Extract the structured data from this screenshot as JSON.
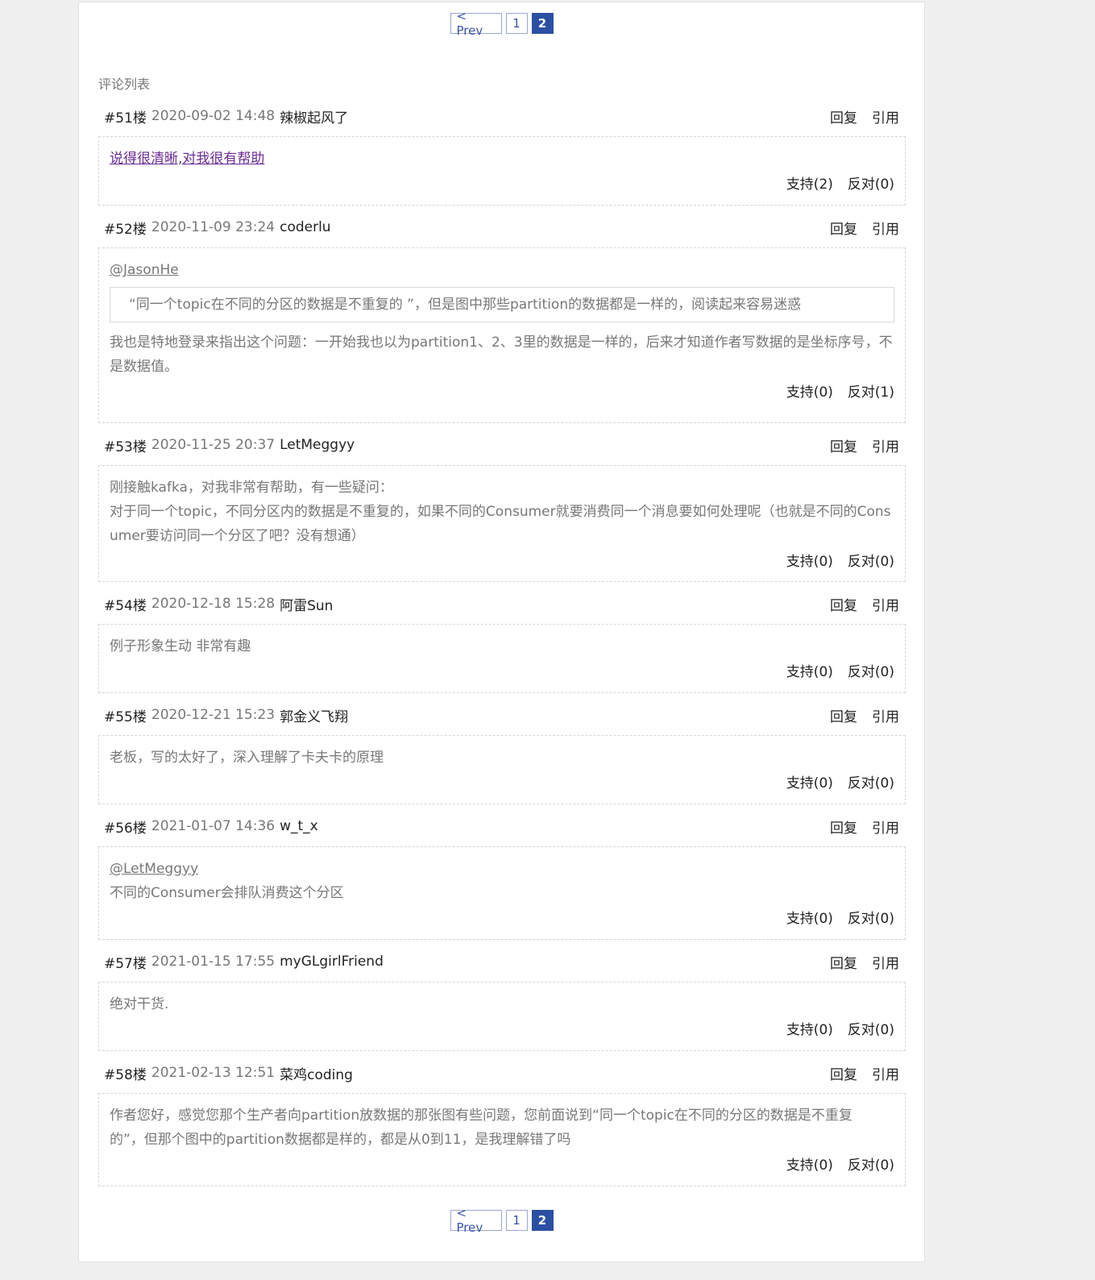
{
  "pager": {
    "prev_label": "< Prev",
    "pages": [
      "1",
      "2"
    ],
    "current": "2"
  },
  "section_title": "评论列表",
  "actions": {
    "reply": "回复",
    "quote": "引用"
  },
  "comments": [
    {
      "floor": "#51楼",
      "date": "2020-09-02 14:48",
      "author": "辣椒起风了",
      "link_text": "说得很清晰,对我很有帮助",
      "support": "支持(2)",
      "oppose": "反对(0)"
    },
    {
      "floor": "#52楼",
      "date": "2020-11-09 23:24",
      "author": "coderlu",
      "mention": "@JasonHe",
      "quote": "“同一个topic在不同的分区的数据是不重复的 ”，但是图中那些partition的数据都是一样的，阅读起来容易迷惑",
      "lines": [
        "我也是特地登录来指出这个问题：一开始我也以为partition1、2、3里的数据是一样的，后来才知道作者写数据的是坐标序号，不",
        "是数据值。"
      ],
      "support": "支持(0)",
      "oppose": "反对(1)"
    },
    {
      "floor": "#53楼",
      "date": "2020-11-25 20:37",
      "author": "LetMeggyy",
      "lines": [
        "刚接触kafka，对我非常有帮助，有一些疑问：",
        "对于同一个topic，不同分区内的数据是不重复的，如果不同的Consumer就要消费同一个消息要如何处理呢（也就是不同的Cons",
        "umer要访问同一个分区了吧？没有想通）"
      ],
      "support": "支持(0)",
      "oppose": "反对(0)"
    },
    {
      "floor": "#54楼",
      "date": "2020-12-18 15:28",
      "author": "阿雷Sun",
      "lines": [
        "例子形象生动 非常有趣"
      ],
      "support": "支持(0)",
      "oppose": "反对(0)"
    },
    {
      "floor": "#55楼",
      "date": "2020-12-21 15:23",
      "author": "郭金义飞翔",
      "lines": [
        "老板，写的太好了，深入理解了卡夫卡的原理"
      ],
      "support": "支持(0)",
      "oppose": "反对(0)"
    },
    {
      "floor": "#56楼",
      "date": "2021-01-07 14:36",
      "author": "w_t_x",
      "mention": "@LetMeggyy",
      "lines": [
        "不同的Consumer会排队消费这个分区"
      ],
      "support": "支持(0)",
      "oppose": "反对(0)"
    },
    {
      "floor": "#57楼",
      "date": "2021-01-15 17:55",
      "author": "myGLgirlFriend",
      "lines": [
        "绝对干货."
      ],
      "support": "支持(0)",
      "oppose": "反对(0)"
    },
    {
      "floor": "#58楼",
      "date": "2021-02-13 12:51",
      "author": "菜鸡coding",
      "lines": [
        "作者您好，感觉您那个生产者向partition放数据的那张图有些问题，您前面说到“同一个topic在不同的分区的数据是不重复",
        "的”，但那个图中的partition数据都是样的，都是从0到11，是我理解错了吗"
      ],
      "support": "支持(0)",
      "oppose": "反对(0)"
    }
  ]
}
